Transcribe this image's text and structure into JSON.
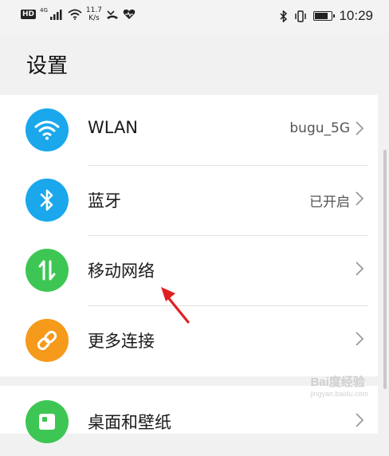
{
  "status_bar": {
    "hd": "HD",
    "network": "4G",
    "speed_value": "11.7",
    "speed_unit": "K/s",
    "time": "10:29",
    "battery_level": 0.85
  },
  "page": {
    "title": "设置"
  },
  "settings": [
    {
      "label": "WLAN",
      "value": "bugu_5G",
      "icon": "wifi-icon",
      "color": "#1aa7ec"
    },
    {
      "label": "蓝牙",
      "value": "已开启",
      "icon": "bluetooth-icon",
      "color": "#1aa7ec"
    },
    {
      "label": "移动网络",
      "value": "",
      "icon": "mobile-data-icon",
      "color": "#3ec654"
    },
    {
      "label": "更多连接",
      "value": "",
      "icon": "link-icon",
      "color": "#f59a1b"
    },
    {
      "label": "桌面和壁纸",
      "value": "",
      "icon": "wallpaper-icon",
      "color": "#3ec654"
    }
  ],
  "watermark": {
    "brand": "Bai度经验",
    "url": "jingyan.baidu.com"
  }
}
